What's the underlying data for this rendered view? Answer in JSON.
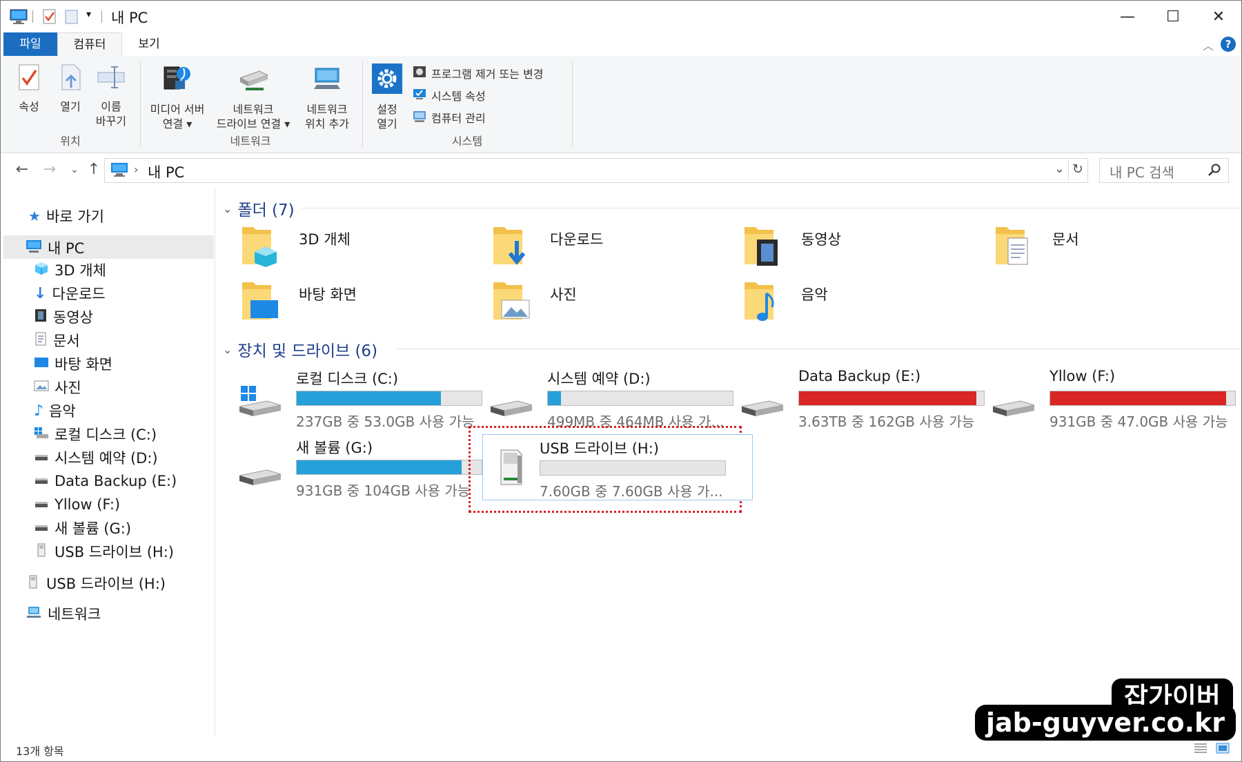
{
  "window": {
    "title": "내 PC",
    "controls": {
      "minimize": "—",
      "maximize": "☐",
      "close": "✕"
    }
  },
  "ribbon_tabs": [
    "파일",
    "컴퓨터",
    "보기"
  ],
  "ribbon": {
    "location": {
      "label": "위치",
      "buttons": [
        {
          "label": "속성"
        },
        {
          "label": "열기"
        },
        {
          "label1": "이름",
          "label2": "바꾸기"
        }
      ]
    },
    "network": {
      "label": "네트워크",
      "buttons": [
        {
          "label1": "미디어 서버",
          "label2": "연결 ▾"
        },
        {
          "label1": "네트워크",
          "label2": "드라이브 연결 ▾"
        },
        {
          "label1": "네트워크",
          "label2": "위치 추가"
        }
      ]
    },
    "system": {
      "label": "시스템",
      "open_settings": {
        "label1": "설정",
        "label2": "열기"
      },
      "items": [
        "프로그램 제거 또는 변경",
        "시스템 속성",
        "컴퓨터 관리"
      ]
    }
  },
  "address": {
    "path": "내 PC",
    "search_placeholder": "내 PC 검색"
  },
  "nav": {
    "quick_access": "바로 가기",
    "this_pc": "내 PC",
    "children": [
      "3D 개체",
      "다운로드",
      "동영상",
      "문서",
      "바탕 화면",
      "사진",
      "음악",
      "로컬 디스크 (C:)",
      "시스템 예약 (D:)",
      "Data Backup (E:)",
      "Yllow (F:)",
      "새 볼륨 (G:)",
      "USB 드라이브 (H:)"
    ],
    "usb_root": "USB 드라이브 (H:)",
    "network": "네트워크"
  },
  "folders_section": {
    "title": "폴더 (7)",
    "items": [
      "3D 개체",
      "다운로드",
      "동영상",
      "문서",
      "바탕 화면",
      "사진",
      "음악"
    ]
  },
  "drives_section": {
    "title": "장치 및 드라이브 (6)",
    "items": [
      {
        "name": "로컬 디스크 (C:)",
        "info": "237GB 중 53.0GB 사용 가능",
        "used_fraction": 0.78,
        "color": "#26a0da"
      },
      {
        "name": "시스템 예약 (D:)",
        "info": "499MB 중 464MB 사용 가...",
        "used_fraction": 0.07,
        "color": "#26a0da"
      },
      {
        "name": "Data Backup (E:)",
        "info": "3.63TB 중 162GB 사용 가능",
        "used_fraction": 0.96,
        "color": "#da2626"
      },
      {
        "name": "Yllow (F:)",
        "info": "931GB 중 47.0GB 사용 가능",
        "used_fraction": 0.95,
        "color": "#da2626"
      },
      {
        "name": "새 볼륨 (G:)",
        "info": "931GB 중 104GB 사용 가능",
        "used_fraction": 0.89,
        "color": "#26a0da"
      },
      {
        "name": "USB 드라이브 (H:)",
        "info": "7.60GB 중 7.60GB 사용 가...",
        "used_fraction": 0.0,
        "color": "#26a0da"
      }
    ]
  },
  "status": {
    "item_count": "13개 항목"
  },
  "watermark": {
    "line1": "잡가이버",
    "line2": "jab-guyver.co.kr"
  },
  "colors": {
    "accent": "#1a6dc0",
    "folder": "#f3c14b",
    "highlight": "#d81f26"
  }
}
